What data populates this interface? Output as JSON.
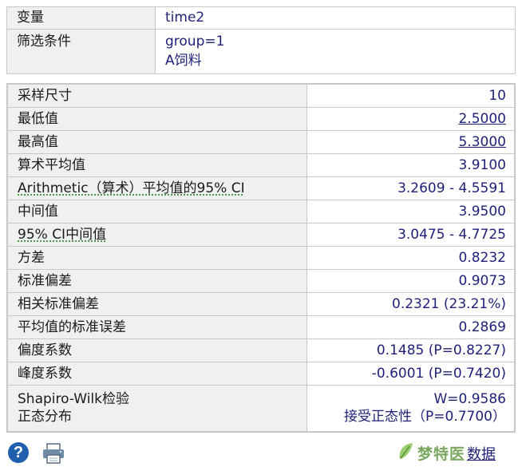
{
  "info": {
    "variable_label": "变量",
    "variable_value": "time2",
    "filter_label": "筛选条件",
    "filter_line1": "group=1",
    "filter_line2": "A饲料"
  },
  "stats": [
    {
      "label": "采样尺寸",
      "value": "10"
    },
    {
      "label": "最低值",
      "value": "2.5000",
      "link": true
    },
    {
      "label": "最高值",
      "value": "5.3000",
      "link": true
    },
    {
      "label": "算术平均值",
      "value": "3.9100"
    },
    {
      "label": "Arithmetic（算术）平均值的95% CI",
      "value": "3.2609 - 4.5591",
      "squiggle": true
    },
    {
      "label": "中间值",
      "value": "3.9500"
    },
    {
      "label": "95% CI中间值",
      "value": "3.0475 - 4.7725",
      "squiggle": true
    },
    {
      "label": "方差",
      "value": "0.8232"
    },
    {
      "label": "标准偏差",
      "value": "0.9073"
    },
    {
      "label": "相关标准偏差",
      "value": "0.2321 (23.21%)"
    },
    {
      "label": "平均值的标准误差",
      "value": "0.2869"
    },
    {
      "label": "偏度系数",
      "value": "0.1485 (P=0.8227)"
    },
    {
      "label": "峰度系数",
      "value": "-0.6001 (P=0.7420)"
    }
  ],
  "normality": {
    "label_line1": "Shapiro-Wilk检验",
    "label_line2": "正态分布",
    "value_line1": "W=0.9586",
    "value_line2": "接受正态性（P=0.7700）"
  },
  "footer": {
    "help_icon": "question-icon",
    "print_icon": "printer-icon",
    "brand_text": "梦特医",
    "brand_link": "数据"
  },
  "colors": {
    "value_text": "#1f1f7a",
    "label_bg": "#f0f0f0",
    "border": "#c8c8c8",
    "help_blue": "#1f5fae",
    "squiggle_green": "#2e8b2e"
  }
}
